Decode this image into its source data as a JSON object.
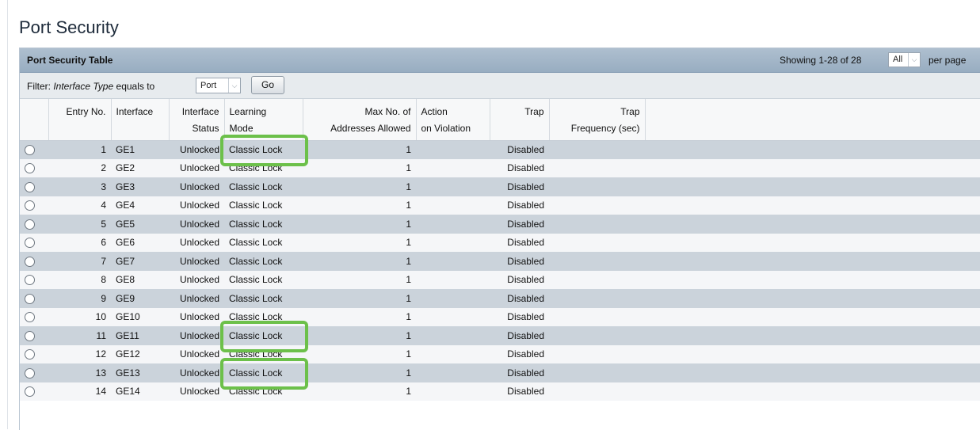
{
  "page": {
    "title": "Port Security"
  },
  "panel": {
    "title": "Port Security Table",
    "showing": "Showing 1-28 of 28",
    "per_page_value": "All",
    "per_page_label": "per page"
  },
  "filter": {
    "prefix": "Filter:",
    "field": "Interface Type",
    "op": "equals to",
    "value": "Port",
    "go_label": "Go"
  },
  "table": {
    "columns": [
      {
        "line1": "",
        "line2": ""
      },
      {
        "line1": "Entry No.",
        "line2": ""
      },
      {
        "line1": "Interface",
        "line2": ""
      },
      {
        "line1": "Interface",
        "line2": "Status"
      },
      {
        "line1": "Learning",
        "line2": "Mode"
      },
      {
        "line1": "Max No. of",
        "line2": "Addresses Allowed"
      },
      {
        "line1": "Action",
        "line2": "on Violation"
      },
      {
        "line1": "Trap",
        "line2": ""
      },
      {
        "line1": "Trap",
        "line2": "Frequency (sec)"
      },
      {
        "line1": "",
        "line2": ""
      }
    ],
    "rows": [
      {
        "entry": "1",
        "interface": "GE1",
        "status": "Unlocked",
        "mode": "Classic Lock",
        "max": "1",
        "action": "",
        "trap": "Disabled",
        "freq": ""
      },
      {
        "entry": "2",
        "interface": "GE2",
        "status": "Unlocked",
        "mode": "Classic Lock",
        "max": "1",
        "action": "",
        "trap": "Disabled",
        "freq": ""
      },
      {
        "entry": "3",
        "interface": "GE3",
        "status": "Unlocked",
        "mode": "Classic Lock",
        "max": "1",
        "action": "",
        "trap": "Disabled",
        "freq": ""
      },
      {
        "entry": "4",
        "interface": "GE4",
        "status": "Unlocked",
        "mode": "Classic Lock",
        "max": "1",
        "action": "",
        "trap": "Disabled",
        "freq": ""
      },
      {
        "entry": "5",
        "interface": "GE5",
        "status": "Unlocked",
        "mode": "Classic Lock",
        "max": "1",
        "action": "",
        "trap": "Disabled",
        "freq": ""
      },
      {
        "entry": "6",
        "interface": "GE6",
        "status": "Unlocked",
        "mode": "Classic Lock",
        "max": "1",
        "action": "",
        "trap": "Disabled",
        "freq": ""
      },
      {
        "entry": "7",
        "interface": "GE7",
        "status": "Unlocked",
        "mode": "Classic Lock",
        "max": "1",
        "action": "",
        "trap": "Disabled",
        "freq": ""
      },
      {
        "entry": "8",
        "interface": "GE8",
        "status": "Unlocked",
        "mode": "Classic Lock",
        "max": "1",
        "action": "",
        "trap": "Disabled",
        "freq": ""
      },
      {
        "entry": "9",
        "interface": "GE9",
        "status": "Unlocked",
        "mode": "Classic Lock",
        "max": "1",
        "action": "",
        "trap": "Disabled",
        "freq": ""
      },
      {
        "entry": "10",
        "interface": "GE10",
        "status": "Unlocked",
        "mode": "Classic Lock",
        "max": "1",
        "action": "",
        "trap": "Disabled",
        "freq": ""
      },
      {
        "entry": "11",
        "interface": "GE11",
        "status": "Unlocked",
        "mode": "Classic Lock",
        "max": "1",
        "action": "",
        "trap": "Disabled",
        "freq": ""
      },
      {
        "entry": "12",
        "interface": "GE12",
        "status": "Unlocked",
        "mode": "Classic Lock",
        "max": "1",
        "action": "",
        "trap": "Disabled",
        "freq": ""
      },
      {
        "entry": "13",
        "interface": "GE13",
        "status": "Unlocked",
        "mode": "Classic Lock",
        "max": "1",
        "action": "",
        "trap": "Disabled",
        "freq": ""
      },
      {
        "entry": "14",
        "interface": "GE14",
        "status": "Unlocked",
        "mode": "Classic Lock",
        "max": "1",
        "action": "",
        "trap": "Disabled",
        "freq": ""
      }
    ]
  },
  "highlight": {
    "color": "#6cc04a",
    "rows": [
      1,
      11,
      13
    ]
  }
}
